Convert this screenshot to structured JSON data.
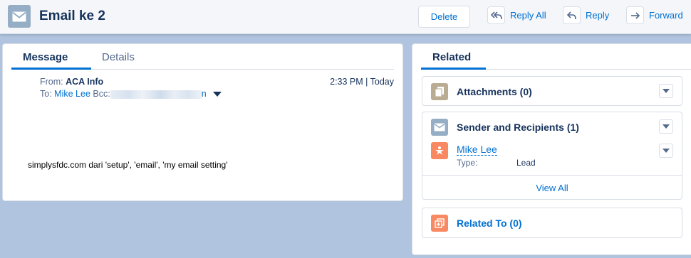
{
  "header": {
    "title": "Email ke 2",
    "delete_label": "Delete",
    "actions": [
      {
        "label": "Reply All",
        "icon": "reply-all-icon"
      },
      {
        "label": "Reply",
        "icon": "reply-icon"
      },
      {
        "label": "Forward",
        "icon": "forward-icon"
      }
    ]
  },
  "message_panel": {
    "tabs": [
      "Message",
      "Details"
    ],
    "from_label": "From:",
    "from_value": "ACA Info",
    "to_label": "To:",
    "to_value": "Mike Lee",
    "bcc_label": "Bcc:",
    "bcc_tail": "n",
    "timestamp": "2:33 PM | Today",
    "body": "simplysfdc.com dari 'setup', 'email', 'my email setting'"
  },
  "related_panel": {
    "tab": "Related",
    "attachments_title": "Attachments (0)",
    "recipients_title": "Sender and Recipients (1)",
    "recipient_name": "Mike Lee",
    "recipient_type_label": "Type:",
    "recipient_type_value": "Lead",
    "view_all": "View All",
    "related_to_title": "Related To (0)"
  },
  "colors": {
    "accent": "#0070d2",
    "email_icon_bg": "#95aec5",
    "attachment_icon_bg": "#baac93",
    "lead_icon_bg": "#f88962",
    "related_icon_bg": "#f88962"
  }
}
